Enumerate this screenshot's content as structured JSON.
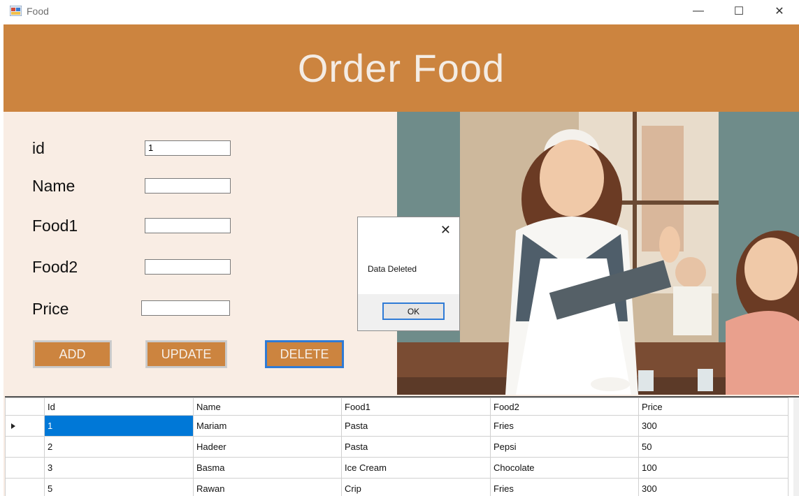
{
  "window": {
    "title": "Food",
    "minimize_glyph": "—",
    "maximize_glyph": "☐",
    "close_glyph": "✕"
  },
  "header": {
    "title": "Order Food"
  },
  "form": {
    "id_label": "id",
    "id_value": "1",
    "name_label": "Name",
    "name_value": "",
    "food1_label": "Food1",
    "food1_value": "",
    "food2_label": "Food2",
    "food2_value": "",
    "price_label": "Price",
    "price_value": ""
  },
  "buttons": {
    "add": "ADD",
    "update": "UPDATE",
    "delete": "DELETE"
  },
  "dialog": {
    "message": "Data Deleted",
    "ok": "OK",
    "close_glyph": "✕"
  },
  "grid": {
    "columns": [
      "Id",
      "Name",
      "Food1",
      "Food2",
      "Price"
    ],
    "rows": [
      {
        "id": "1",
        "name": "Mariam",
        "food1": "Pasta",
        "food2": "Fries",
        "price": "300"
      },
      {
        "id": "2",
        "name": "Hadeer",
        "food1": "Pasta",
        "food2": "Pepsi",
        "price": "50"
      },
      {
        "id": "3",
        "name": "Basma",
        "food1": "Ice Cream",
        "food2": "Chocolate",
        "price": "100"
      },
      {
        "id": "5",
        "name": "Rawan",
        "food1": "Crip",
        "food2": "Fries",
        "price": "300"
      }
    ]
  },
  "colors": {
    "accent": "#cc843f",
    "panel": "#f9ede4",
    "selection": "#0078d7"
  }
}
